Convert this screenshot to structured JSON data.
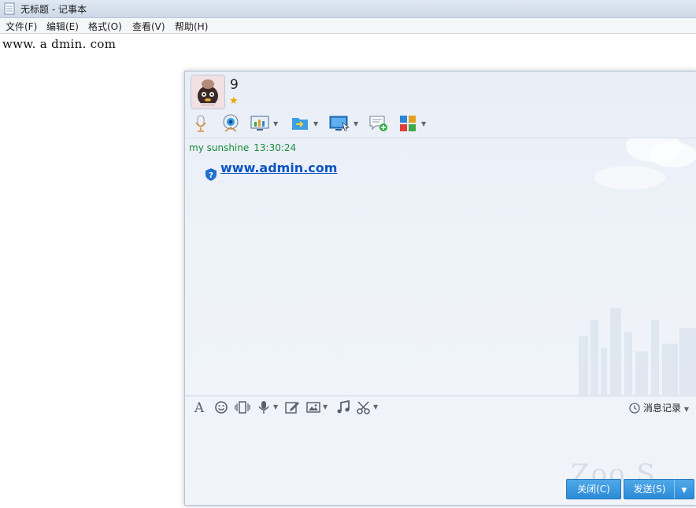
{
  "notepad": {
    "title": "无标题 - 记事本",
    "menu": [
      "文件(F)",
      "编辑(E)",
      "格式(O)",
      "查看(V)",
      "帮助(H)"
    ],
    "content": "www. a dmin. com"
  },
  "chat": {
    "contact_name": "9",
    "message": {
      "sender": "my sunshine",
      "time": "13:30:24",
      "link": "www.admin.com"
    },
    "history_label": "消息记录",
    "close_button": "关闭(C)",
    "send_button": "发送(S)",
    "watermark": "Zoo S"
  },
  "colors": {
    "accent": "#2c8bd6",
    "link": "#0b55c4",
    "sender_green": "#178a3c"
  },
  "icons": {
    "top_toolbar": [
      "microphone-icon",
      "webcam-icon",
      "screen-share-icon",
      "file-transfer-icon",
      "remote-desktop-icon",
      "chat-add-icon",
      "apps-icon"
    ],
    "bottom_toolbar": [
      "font-icon",
      "emoji-icon",
      "shake-icon",
      "voice-message-icon",
      "edit-icon",
      "image-icon",
      "music-icon",
      "scissors-icon"
    ]
  }
}
